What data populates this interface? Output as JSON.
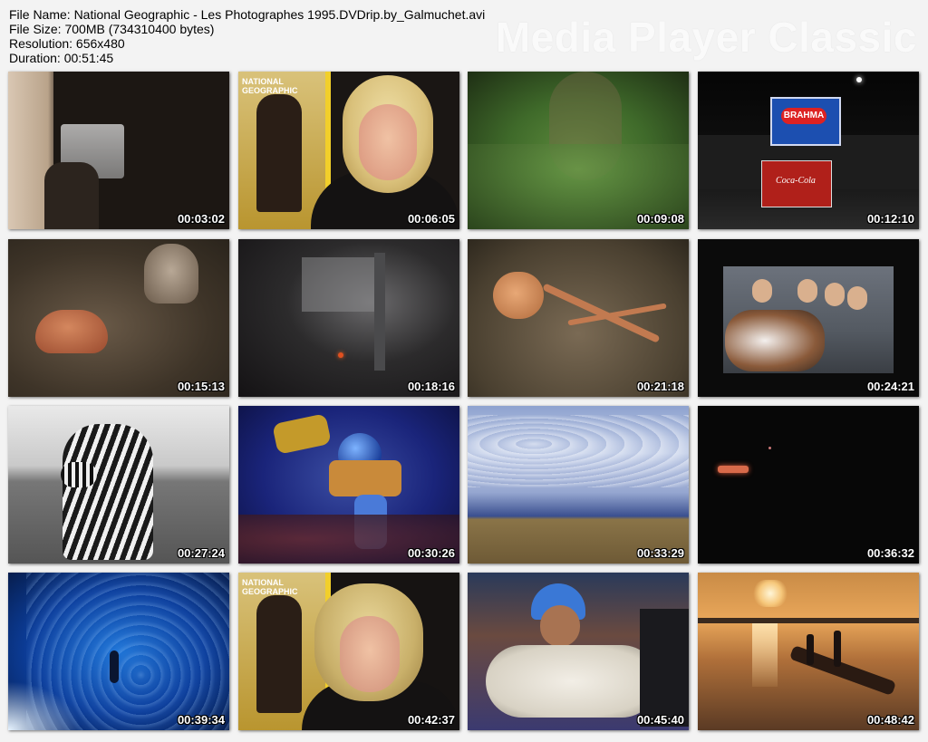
{
  "info": {
    "file_name": "File Name:  National Geographic - Les Photographes 1995.DVDrip.by_Galmuchet.avi",
    "file_size": "File Size: 700MB (734310400 bytes)",
    "resolution": "Resolution: 656x480",
    "duration": "Duration: 00:51:45"
  },
  "brand": "Media Player Classic",
  "thumbnails": [
    {
      "time": "00:03:02"
    },
    {
      "time": "00:06:05"
    },
    {
      "time": "00:09:08"
    },
    {
      "time": "00:12:10"
    },
    {
      "time": "00:15:13"
    },
    {
      "time": "00:18:16"
    },
    {
      "time": "00:21:18"
    },
    {
      "time": "00:24:21"
    },
    {
      "time": "00:27:24"
    },
    {
      "time": "00:30:26"
    },
    {
      "time": "00:33:29"
    },
    {
      "time": "00:36:32"
    },
    {
      "time": "00:39:34"
    },
    {
      "time": "00:42:37"
    },
    {
      "time": "00:45:40"
    },
    {
      "time": "00:48:42"
    }
  ],
  "signs": {
    "brahma": "BRAHMA",
    "cocacola": "Coca-Cola",
    "national_geographic": "NATIONAL GEOGRAPHIC"
  }
}
